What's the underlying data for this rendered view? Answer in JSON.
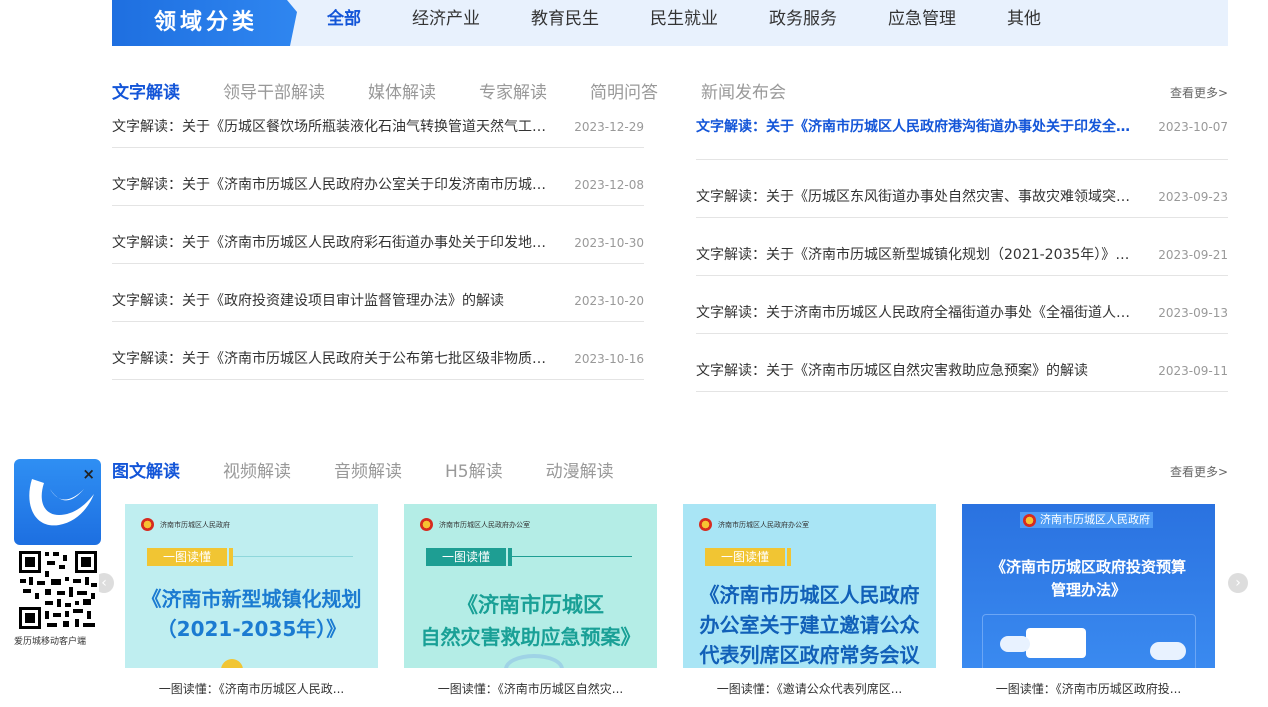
{
  "category_bar": {
    "title": "领域分类",
    "tabs": [
      "全部",
      "经济产业",
      "教育民生",
      "民生就业",
      "政务服务",
      "应急管理",
      "其他"
    ]
  },
  "text_section": {
    "tabs": [
      "文字解读",
      "领导干部解读",
      "媒体解读",
      "专家解读",
      "简明问答",
      "新闻发布会"
    ],
    "more": "查看更多>",
    "left_items": [
      {
        "title": "文字解读：关于《历城区餐饮场所瓶装液化石油气转换管道天然气工作...",
        "date": "2023-12-29"
      },
      {
        "title": "文字解读：关于《济南市历城区人民政府办公室关于印发济南市历城区...",
        "date": "2023-12-08"
      },
      {
        "title": "文字解读：关于《济南市历城区人民政府彩石街道办事处关于印发地震...",
        "date": "2023-10-30"
      },
      {
        "title": "文字解读：关于《政府投资建设项目审计监督管理办法》的解读",
        "date": "2023-10-20"
      },
      {
        "title": "文字解读：关于《济南市历城区人民政府关于公布第七批区级非物质文...",
        "date": "2023-10-16"
      }
    ],
    "right_items": [
      {
        "title": "文字解读：关于《济南市历城区人民政府港沟街道办事处关于印发全面...",
        "date": "2023-10-07"
      },
      {
        "title": "文字解读：关于《历城区东风街道办事处自然灾害、事故灾难领域突发...",
        "date": "2023-09-23"
      },
      {
        "title": "文字解读：关于《济南市历城区新型城镇化规划（2021-2035年）》的...",
        "date": "2023-09-21"
      },
      {
        "title": "文字解读：关于济南市历城区人民政府全福街道办事处《全福街道人居...",
        "date": "2023-09-13"
      },
      {
        "title": "文字解读：关于《济南市历城区自然灾害救助应急预案》的解读",
        "date": "2023-09-11"
      }
    ]
  },
  "graphic_section": {
    "tabs": [
      "图文解读",
      "视频解读",
      "音频解读",
      "H5解读",
      "动漫解读"
    ],
    "more": "查看更多>",
    "cards": [
      {
        "caption": "一图读懂：《济南市历城区人民政...",
        "org": "济南市历城区人民政府",
        "badge": "一图读懂",
        "lines": [
          "《济南市新型城镇化规划",
          "（2021-2035年）》"
        ]
      },
      {
        "caption": "一图读懂：《济南市历城区自然灾...",
        "org": "济南市历城区人民政府办公室",
        "badge": "一图读懂",
        "lines": [
          "《济南市历城区",
          "自然灾害救助应急预案》"
        ]
      },
      {
        "caption": "一图读懂：《邀请公众代表列席区...",
        "org": "济南市历城区人民政府办公室",
        "badge": "一图读懂",
        "lines": [
          "《济南市历城区人民政府",
          "办公室关于建立邀请公众",
          "代表列席区政府常务会议"
        ]
      },
      {
        "caption": "一图读懂：《济南市历城区政府投...",
        "org": "济南市历城区人民政府",
        "badge": "",
        "lines": [
          "《济南市历城区政府投资预算",
          "管理办法》"
        ]
      }
    ]
  },
  "app_widget": {
    "label": "爱历城移动客户端",
    "close": "×"
  },
  "icons": {
    "prev": "chevron-left-icon",
    "next": "chevron-right-icon"
  }
}
